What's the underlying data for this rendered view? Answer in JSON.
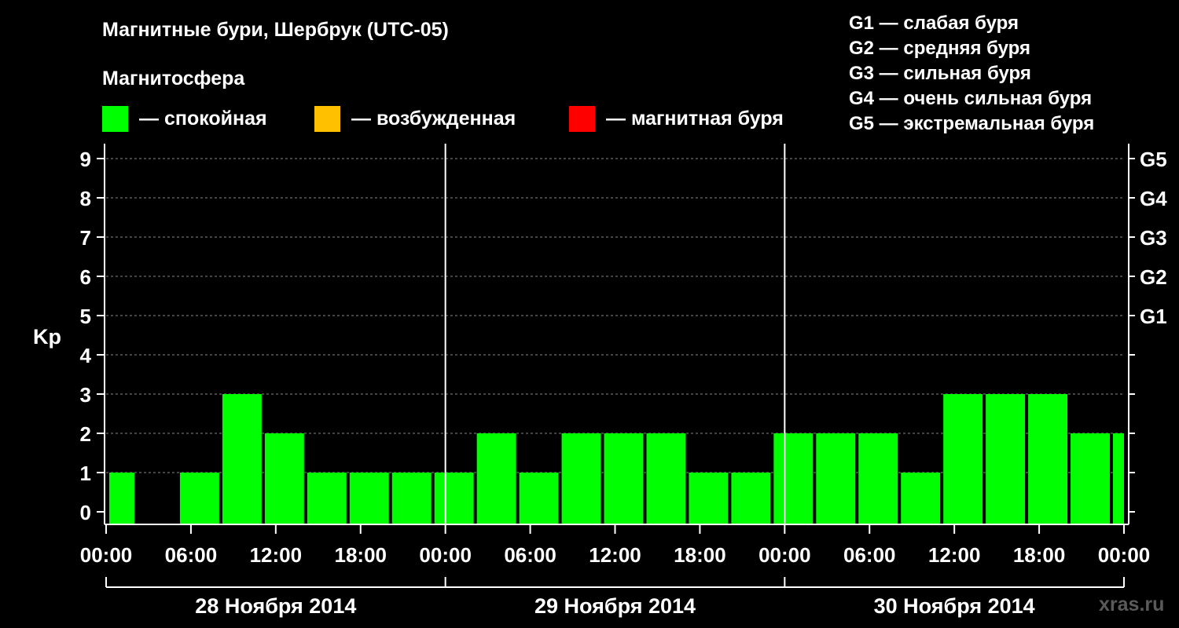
{
  "header": {
    "title": "Магнитные бури, Шербрук (UTC-05)",
    "subtitle": "Магнитосфера"
  },
  "legend": [
    {
      "label": "— спокойная",
      "color": "#00ff00"
    },
    {
      "label": "— возбужденная",
      "color": "#ffc000"
    },
    {
      "label": "— магнитная буря",
      "color": "#ff0000"
    }
  ],
  "storm_levels": [
    "G1 — слабая буря",
    "G2 — средняя буря",
    "G3 — сильная буря",
    "G4 — очень сильная буря",
    "G5 — экстремальная буря"
  ],
  "site": "xras.ru",
  "chart_data": {
    "type": "bar",
    "ylabel": "Kp",
    "ylim": [
      0,
      9
    ],
    "yticks": [
      0,
      1,
      2,
      3,
      4,
      5,
      6,
      7,
      8,
      9
    ],
    "right_axis_labels": [
      {
        "kp": 5,
        "label": "G1"
      },
      {
        "kp": 6,
        "label": "G2"
      },
      {
        "kp": 7,
        "label": "G3"
      },
      {
        "kp": 8,
        "label": "G4"
      },
      {
        "kp": 9,
        "label": "G5"
      }
    ],
    "xticks": [
      "00:00",
      "06:00",
      "12:00",
      "18:00",
      "00:00",
      "06:00",
      "12:00",
      "18:00",
      "00:00",
      "06:00",
      "12:00",
      "18:00",
      "00:00"
    ],
    "days": [
      "28 Ноября 2014",
      "29 Ноября 2014",
      "30 Ноября 2014"
    ],
    "grid": true,
    "bar_color": "#00ff00",
    "bar_interval_hours": 3,
    "start_hours_offset": -1,
    "values": [
      1,
      0,
      1,
      3,
      2,
      1,
      1,
      1,
      1,
      2,
      1,
      2,
      2,
      2,
      1,
      1,
      2,
      2,
      2,
      1,
      3,
      3,
      3,
      2,
      2
    ]
  }
}
